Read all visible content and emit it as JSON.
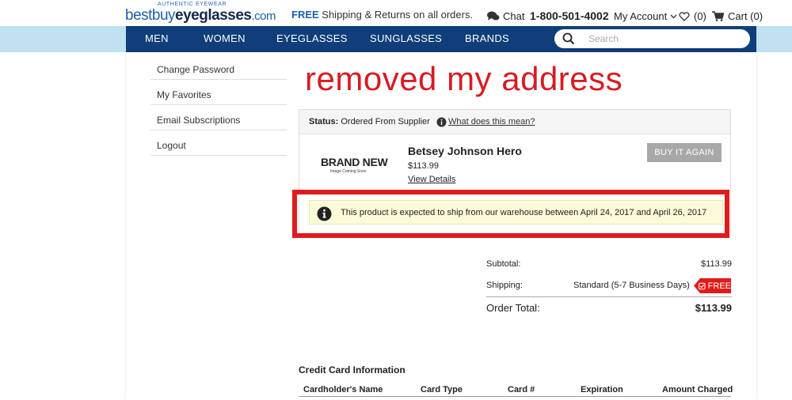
{
  "header": {
    "logo_tagline": "AUTHENTIC EYEWEAR",
    "logo_part1": "bestbuy",
    "logo_part2": "eyeglasses",
    "logo_part3": ".com",
    "promo_bold": "FREE",
    "promo_text": " Shipping & Returns on all orders.",
    "chat_label": "Chat",
    "phone": "1-800-501-4002",
    "account_label": "My Account",
    "favorites_count": "(0)",
    "cart_label": "Cart (0)"
  },
  "nav": {
    "items": [
      "MEN",
      "WOMEN",
      "EYEGLASSES",
      "SUNGLASSES",
      "BRANDS"
    ],
    "search_placeholder": "Search"
  },
  "sidebar": {
    "items": [
      "Change Password",
      "My Favorites",
      "Email Subscriptions",
      "Logout"
    ]
  },
  "annotation": "removed my address",
  "order": {
    "status_label": "Status:",
    "status_value": "Ordered From Supplier",
    "status_link": "What does this mean?",
    "image_placeholder_title": "BRAND NEW",
    "image_placeholder_sub": "Image Coming Soon",
    "product_name": "Betsey Johnson Hero",
    "product_price": "$113.99",
    "view_details": "View Details",
    "buy_again": "BUY IT AGAIN",
    "ship_note": "This product is expected to ship from our warehouse between April 24, 2017 and April 26, 2017"
  },
  "summary": {
    "subtotal_label": "Subtotal:",
    "subtotal_value": "$113.99",
    "shipping_label": "Shipping:",
    "shipping_method": "Standard (5-7 Business Days)",
    "free_badge": "FREE",
    "total_label": "Order Total:",
    "total_value": "$113.99"
  },
  "credit_card": {
    "title": "Credit Card Information",
    "columns": [
      "Cardholder's Name",
      "Card Type",
      "Card #",
      "Expiration",
      "Amount Charged"
    ]
  },
  "colors": {
    "nav_bg": "#0f3e7a",
    "strip_bg": "#bfe1f2",
    "annotation": "#d81b24",
    "highlight_box": "#e01b1b"
  }
}
